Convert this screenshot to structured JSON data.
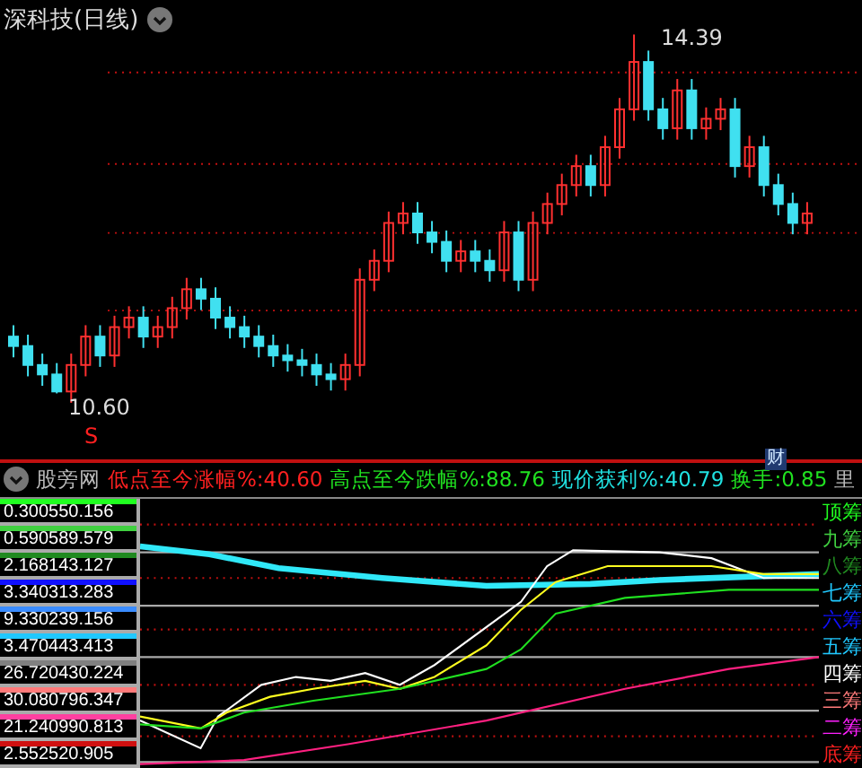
{
  "title": "深科技(日线)",
  "chart_markers": [
    {
      "kind": "high",
      "text": "14.39"
    },
    {
      "kind": "low",
      "text": "10.60"
    },
    {
      "kind": "signal",
      "text": "S"
    },
    {
      "kind": "event",
      "text": "财"
    }
  ],
  "indicator": {
    "name": "股旁网",
    "stats": [
      {
        "label": "低点至今涨幅%:",
        "value": "40.60",
        "color": "#ff2020"
      },
      {
        "label": "高点至今跌幅%:",
        "value": "88.76",
        "color": "#20e020"
      },
      {
        "label": "现价获利%:",
        "value": "40.79",
        "color": "#20e0e0"
      },
      {
        "label": "换手:",
        "value": "0.85",
        "color": "#20e020"
      }
    ],
    "overflow": "里"
  },
  "bands": [
    {
      "text": "0.300550.156",
      "color": "#20ff20"
    },
    {
      "text": "0.590589.579",
      "color": "#40d040"
    },
    {
      "text": "2.168143.127",
      "color": "#208a20"
    },
    {
      "text": "3.340313.283",
      "color": "#1010ff"
    },
    {
      "text": "9.330239.156",
      "color": "#3a8cff"
    },
    {
      "text": "3.470443.413",
      "color": "#20c8ff"
    },
    {
      "text": "26.720430.224",
      "color": "#808080"
    },
    {
      "text": "30.080796.347",
      "color": "#ff7a7a"
    },
    {
      "text": "21.240990.813",
      "color": "#ff40a0"
    },
    {
      "text": "2.552520.905",
      "color": "#d01010"
    }
  ],
  "levels": [
    {
      "text": "顶筹",
      "color": "#20ff20"
    },
    {
      "text": "九筹",
      "color": "#40d040"
    },
    {
      "text": "八筹",
      "color": "#208a20"
    },
    {
      "text": "七筹",
      "color": "#20c8ff"
    },
    {
      "text": "六筹",
      "color": "#1010ff"
    },
    {
      "text": "五筹",
      "color": "#20c8ff"
    },
    {
      "text": "四筹",
      "color": "#ffffff"
    },
    {
      "text": "三筹",
      "color": "#ff7a7a"
    },
    {
      "text": "二筹",
      "color": "#ff20ff"
    },
    {
      "text": "底筹",
      "color": "#ff2020"
    }
  ]
}
